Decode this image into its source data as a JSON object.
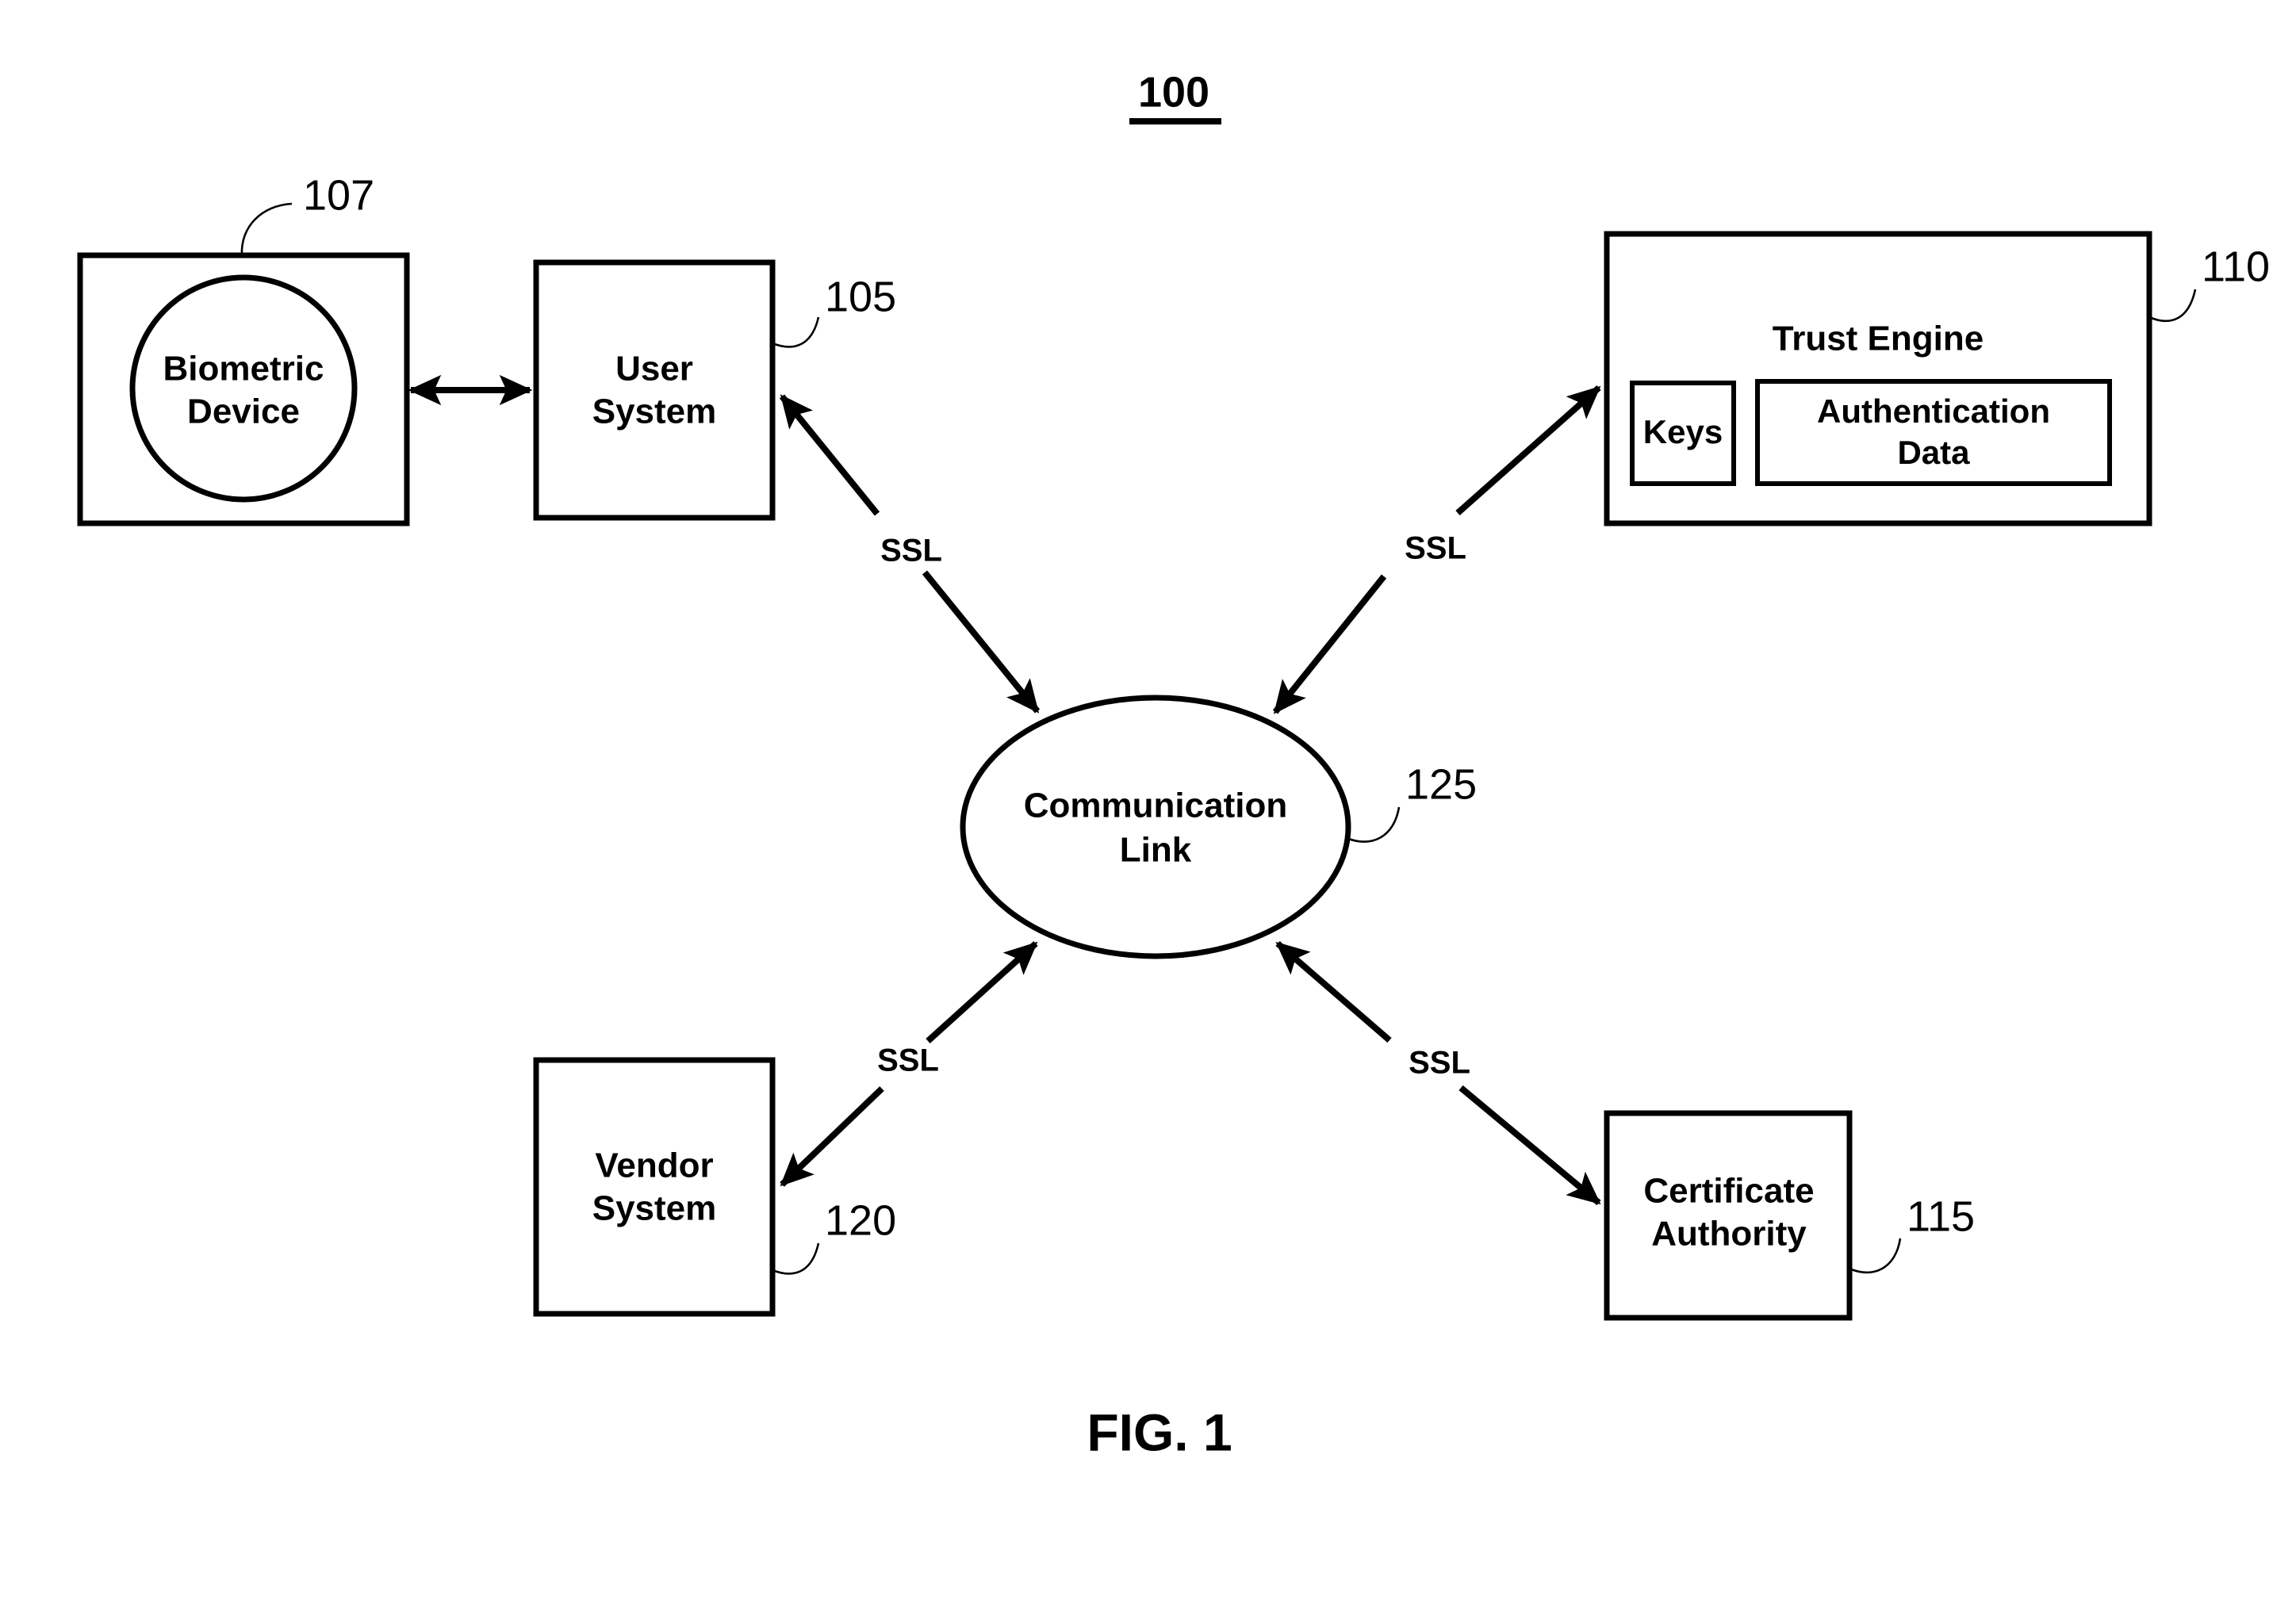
{
  "figure": {
    "number_label": "100",
    "caption": "FIG. 1"
  },
  "nodes": {
    "biometric_device": {
      "label_line1": "Biometric",
      "label_line2": "Device",
      "ref": "107"
    },
    "user_system": {
      "label_line1": "User",
      "label_line2": "System",
      "ref": "105"
    },
    "trust_engine": {
      "title": "Trust Engine",
      "ref": "110",
      "keys": "Keys",
      "auth_data_line1": "Authentication",
      "auth_data_line2": "Data"
    },
    "communication_link": {
      "label_line1": "Communication",
      "label_line2": "Link",
      "ref": "125"
    },
    "vendor_system": {
      "label_line1": "Vendor",
      "label_line2": "System",
      "ref": "120"
    },
    "certificate_authority": {
      "label_line1": "Certificate",
      "label_line2": "Authority",
      "ref": "115"
    }
  },
  "connections": {
    "user_to_link": "SSL",
    "link_to_trust_engine": "SSL",
    "vendor_to_link": "SSL",
    "link_to_certificate_authority": "SSL"
  },
  "colors": {
    "stroke": "#000000",
    "background": "#ffffff"
  }
}
